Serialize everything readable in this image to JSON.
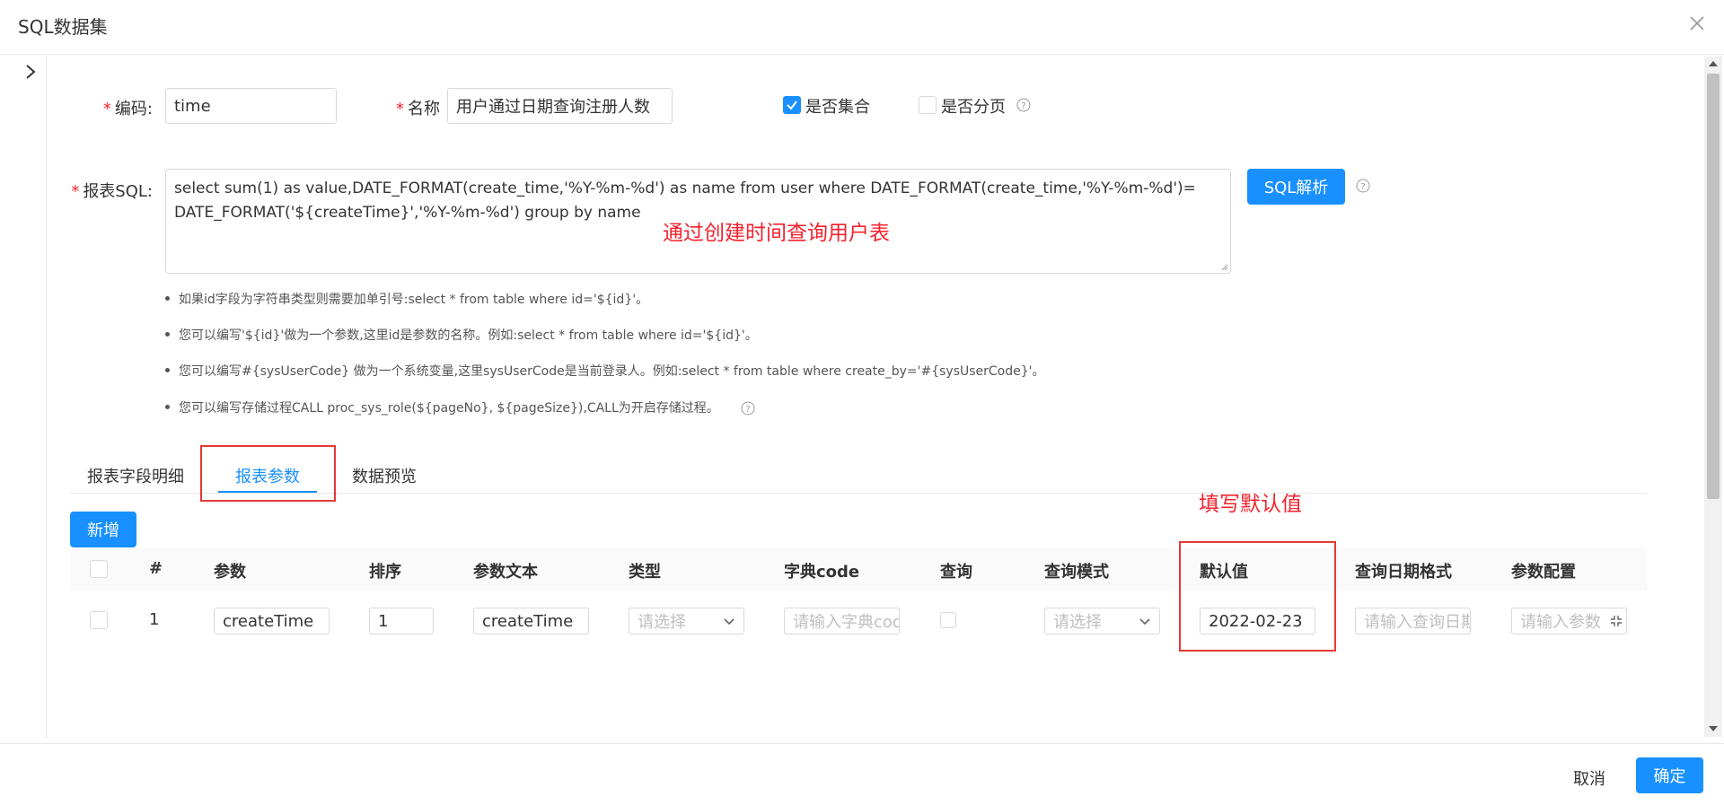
{
  "dialog": {
    "title": "SQL数据集"
  },
  "form": {
    "code_label": "编码:",
    "code_value": "time",
    "name_label": "名称",
    "name_value": "用户通过日期查询注册人数",
    "is_collection_label": "是否集合",
    "is_collection_checked": true,
    "is_paged_label": "是否分页",
    "is_paged_checked": false,
    "sql_label": "报表SQL:",
    "sql_value_line1": "select sum(1) as value,DATE_FORMAT(create_time,'%Y-%m-%d') as name from user where  DATE_FORMAT(create_time,'%Y-%m-%d')=",
    "sql_value_line2": "DATE_FORMAT('${createTime}','%Y-%m-%d')  group by name",
    "sql_parse_button": "SQL解析"
  },
  "annotations": {
    "sql_note": "通过创建时间查询用户表",
    "default_note": "填写默认值"
  },
  "tips": [
    "如果id字段为字符串类型则需要加单引号:select * from table where id='${id}'。",
    "您可以编写'${id}'做为一个参数,这里id是参数的名称。例如:select * from table where id='${id}'。",
    "您可以编写#{sysUserCode} 做为一个系统变量,这里sysUserCode是当前登录人。例如:select * from table where create_by='#{sysUserCode}'。",
    "您可以编写存储过程CALL proc_sys_role(${pageNo}, ${pageSize}),CALL为开启存储过程。"
  ],
  "tabs": [
    {
      "label": "报表字段明细",
      "active": false
    },
    {
      "label": "报表参数",
      "active": true
    },
    {
      "label": "数据预览",
      "active": false
    }
  ],
  "toolbar": {
    "add_label": "新增"
  },
  "table": {
    "columns": [
      "#",
      "参数",
      "排序",
      "参数文本",
      "类型",
      "字典code",
      "查询",
      "查询模式",
      "默认值",
      "查询日期格式",
      "参数配置"
    ],
    "rows": [
      {
        "index": "1",
        "param": "createTime",
        "order": "1",
        "param_text": "createTime",
        "type_placeholder": "请选择",
        "dict_placeholder": "请输入字典code",
        "query_checked": false,
        "query_mode_placeholder": "请选择",
        "default_value": "2022-02-23",
        "date_format_placeholder": "请输入查询日期格式",
        "config_placeholder": "请输入参数配置"
      }
    ]
  },
  "footer": {
    "cancel": "取消",
    "confirm": "确定"
  },
  "colors": {
    "primary": "#1890ff",
    "required": "#f5222d",
    "annotation": "#e53935"
  }
}
